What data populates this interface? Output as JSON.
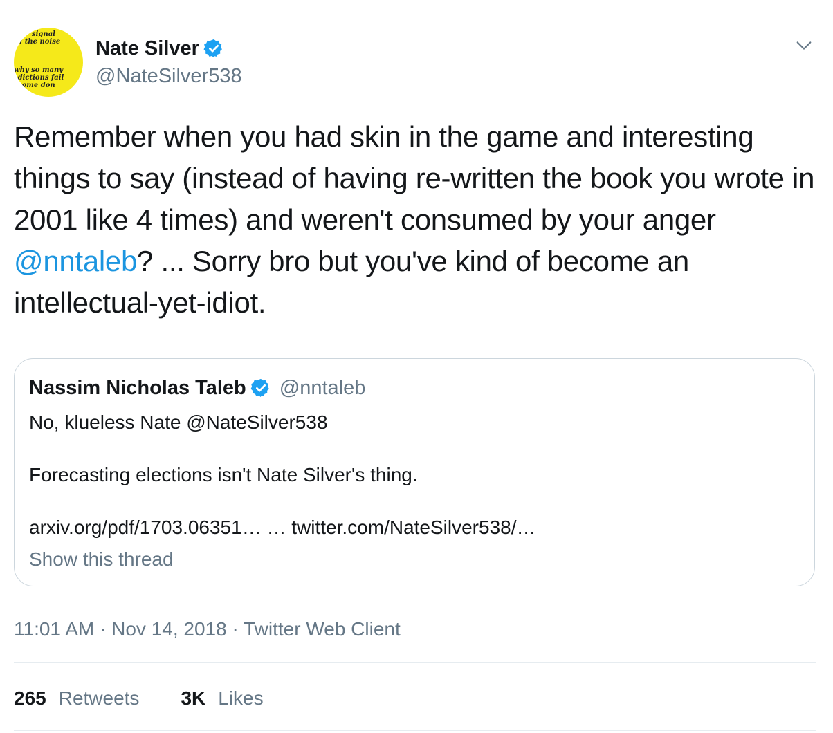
{
  "author": {
    "display_name": "Nate Silver",
    "handle": "@NateSilver538",
    "verified": true,
    "avatar_text": [
      "signal",
      "nd the noise",
      "why so many",
      "redictions fail",
      "some don"
    ]
  },
  "tweet": {
    "text_before": "Remember when you had skin in the game and interesting things to say (instead of having re-written the book you wrote in 2001 like 4 times) and weren't consumed by your anger ",
    "mention": "@nntaleb",
    "text_after": "? ... Sorry bro but you've kind of become an intellectual-yet-idiot."
  },
  "quoted": {
    "display_name": "Nassim Nicholas Taleb",
    "handle": "@nntaleb",
    "verified": true,
    "line1": "No, klueless Nate @NateSilver538",
    "line2": "Forecasting elections isn't Nate Silver's thing.",
    "line3": "arxiv.org/pdf/1703.06351… … twitter.com/NateSilver538/…",
    "show_thread": "Show this thread"
  },
  "meta": {
    "time": "11:01 AM",
    "sep1": " · ",
    "date": "Nov 14, 2018",
    "sep2": " · ",
    "client": "Twitter Web Client"
  },
  "stats": {
    "retweets_count": "265",
    "retweets_label": "Retweets",
    "likes_count": "3K",
    "likes_label": "Likes"
  },
  "colors": {
    "link": "#1b95e0",
    "secondary_text": "#657786",
    "border": "#ccd6dd",
    "verified_badge": "#1da1f2",
    "avatar_bg": "#f5e91a"
  },
  "icons": {
    "verified": "verified-badge-icon",
    "caret": "chevron-down-icon"
  }
}
